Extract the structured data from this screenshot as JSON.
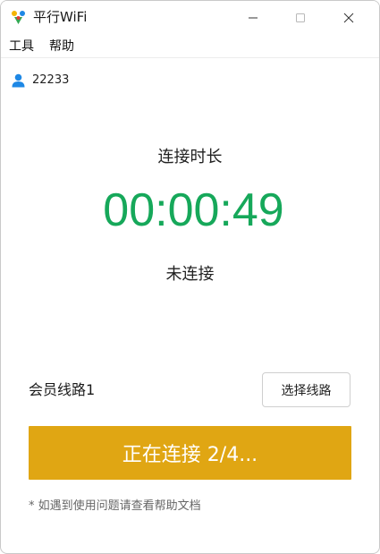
{
  "window": {
    "title": "平行WiFi",
    "icon": "app-logo-icon",
    "controls": [
      "minimize-icon",
      "maximize-icon",
      "close-icon"
    ]
  },
  "menu": {
    "tools": "工具",
    "help": "帮助"
  },
  "user": {
    "icon": "user-icon",
    "name": "22233"
  },
  "connection": {
    "duration_label": "连接时长",
    "timer": "00:00:49",
    "status": "未连接"
  },
  "route": {
    "name": "会员线路1",
    "select_label": "选择线路"
  },
  "connect_button": {
    "label": "正在连接 2/4..."
  },
  "footer": {
    "note": "* 如遇到使用问题请查看帮助文档"
  },
  "colors": {
    "timer": "#16a85a",
    "connect_button": "#e0a613",
    "user_icon": "#1e88e5"
  }
}
